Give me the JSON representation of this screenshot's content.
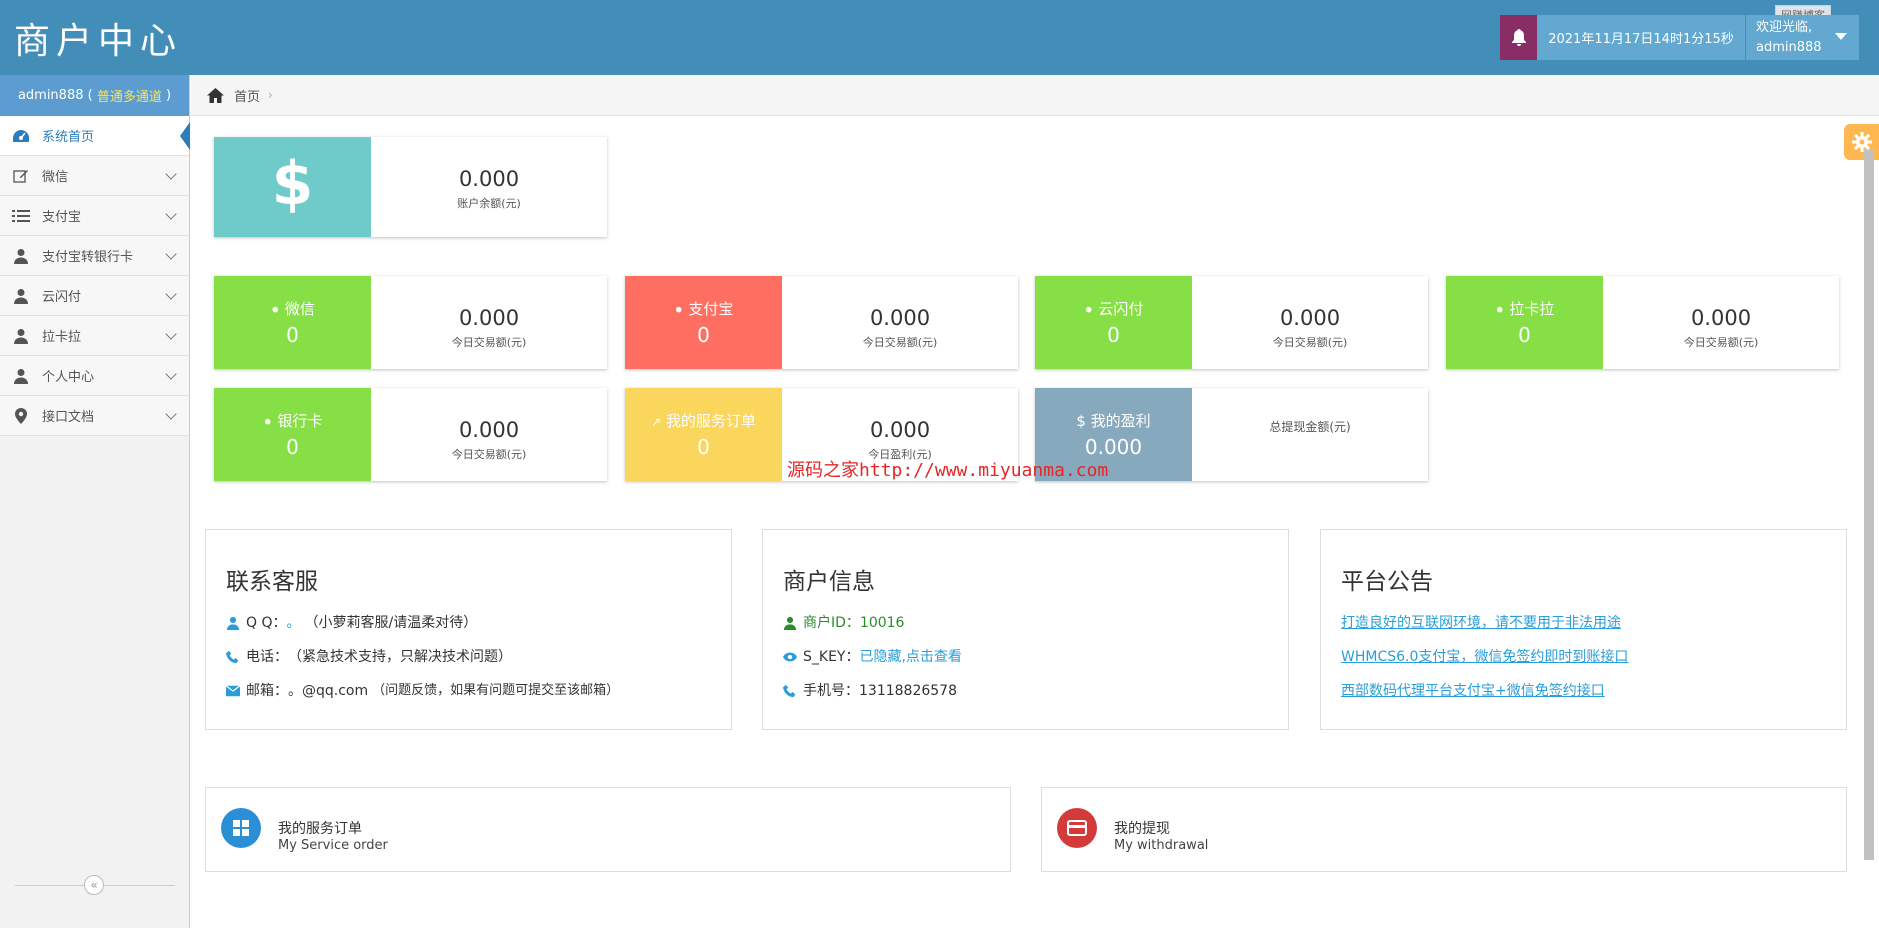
{
  "header": {
    "brand": "商户中心",
    "datetime": "2021年11月17日14时1分15秒",
    "welcome": "欢迎光临,",
    "username": "admin888",
    "tag": "网赚博客"
  },
  "sidebar": {
    "user": "admin888",
    "user_open": " ( ",
    "channel": "普通多通道",
    "user_close": " )",
    "items": [
      {
        "label": "系统首页"
      },
      {
        "label": "微信"
      },
      {
        "label": "支付宝"
      },
      {
        "label": "支付宝转银行卡"
      },
      {
        "label": "云闪付"
      },
      {
        "label": "拉卡拉"
      },
      {
        "label": "个人中心"
      },
      {
        "label": "接口文档"
      }
    ],
    "collapse": "«"
  },
  "breadcrumb": {
    "home": "首页",
    "sep": "›"
  },
  "balance": {
    "value": "0.000",
    "label": "账户余额(元)",
    "symbol": "$"
  },
  "channels": [
    {
      "title": "微信",
      "count": "0",
      "value": "0.000",
      "label": "今日交易额(元)"
    },
    {
      "title": "支付宝",
      "count": "0",
      "value": "0.000",
      "label": "今日交易额(元)"
    },
    {
      "title": "云闪付",
      "count": "0",
      "value": "0.000",
      "label": "今日交易额(元)"
    },
    {
      "title": "拉卡拉",
      "count": "0",
      "value": "0.000",
      "label": "今日交易额(元)"
    },
    {
      "title": "银行卡",
      "count": "0",
      "value": "0.000",
      "label": "今日交易额(元)"
    },
    {
      "title": "我的服务订单",
      "count": "0",
      "value": "0.000",
      "label": "今日盈利(元)"
    },
    {
      "title": "$ 我的盈利",
      "count": "0.000",
      "value": "",
      "label": "总提现金额(元)"
    }
  ],
  "watermark": "源码之家http://www.miyuanma.com",
  "contact": {
    "title": "联系客服",
    "qq_label": "Q Q：",
    "qq_value": "。",
    "qq_note": "（小萝莉客服/请温柔对待）",
    "phone_label": "电话：",
    "phone_note": "（紧急技术支持，只解决技术问题）",
    "email_label": "邮箱：",
    "email_value": "。@qq.com",
    "email_note": "（问题反馈，如果有问题可提交至该邮箱）"
  },
  "merchant": {
    "title": "商户信息",
    "id_label": "商户ID：",
    "id_value": "10016",
    "key_label": "S_KEY：",
    "key_value": "已隐藏,点击查看",
    "phone_label": "手机号：",
    "phone_value": "13118826578"
  },
  "notice": {
    "title": "平台公告",
    "items": [
      "打造良好的互联网环境，请不要用于非法用途",
      "WHMCS6.0支付宝，微信免签约即时到账接口",
      "西部数码代理平台支付宝+微信免签约接口"
    ]
  },
  "shortcuts": [
    {
      "title": "我的服务订单",
      "subtitle": "My Service order",
      "color": "#2b8fd6"
    },
    {
      "title": "我的提现",
      "subtitle": "My withdrawal",
      "color": "#d33a3a"
    }
  ]
}
